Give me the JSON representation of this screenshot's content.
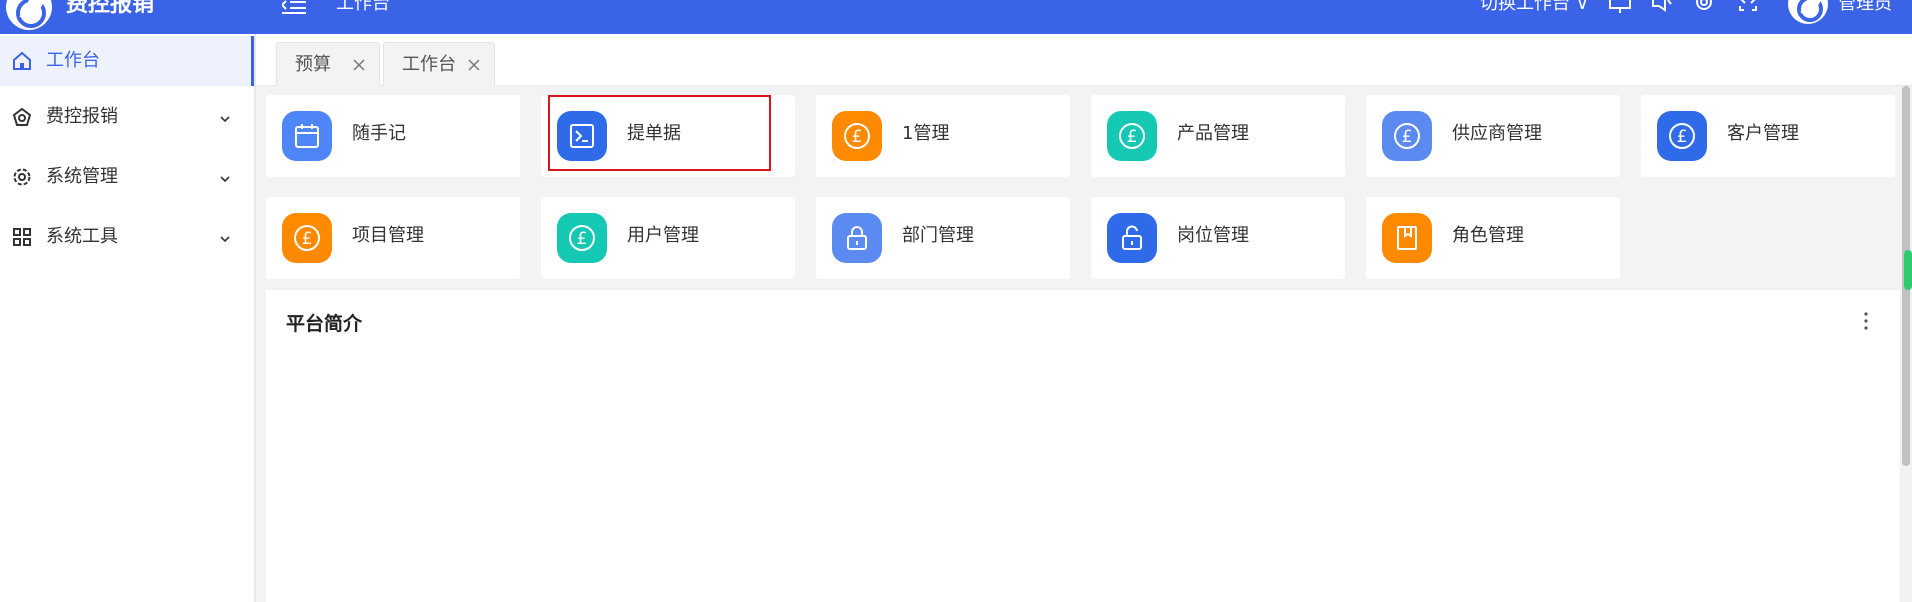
{
  "app": {
    "title": "费控报销"
  },
  "topbar": {
    "page_title": "工作台",
    "switch_workspace": "切换工作台 ∨",
    "user_name": "管理员"
  },
  "sidebar": {
    "items": [
      {
        "label": "工作台",
        "icon": "home-icon",
        "active": true
      },
      {
        "label": "费控报销",
        "icon": "money-icon"
      },
      {
        "label": "系统管理",
        "icon": "gear-icon"
      },
      {
        "label": "系统工具",
        "icon": "grid-icon"
      }
    ]
  },
  "tabs": [
    {
      "label": "预算"
    },
    {
      "label": "工作台"
    }
  ],
  "shortcuts": [
    {
      "label": "随手记",
      "icon": "calendar-icon",
      "color": "#4f86f7"
    },
    {
      "label": "提单据",
      "icon": "terminal-icon",
      "color": "#2f6ae8"
    },
    {
      "label": "1管理",
      "icon": "pound-icon",
      "color": "#ff8a00"
    },
    {
      "label": "产品管理",
      "icon": "pound-icon",
      "color": "#14c8b4"
    },
    {
      "label": "供应商管理",
      "icon": "pound-icon",
      "color": "#5b8af0"
    },
    {
      "label": "客户管理",
      "icon": "pound-icon",
      "color": "#2f6ae8"
    },
    {
      "label": "项目管理",
      "icon": "pound-icon",
      "color": "#ff8a00"
    },
    {
      "label": "用户管理",
      "icon": "pound-icon",
      "color": "#14c8b4"
    },
    {
      "label": "部门管理",
      "icon": "lock-icon",
      "color": "#5b8af0"
    },
    {
      "label": "岗位管理",
      "icon": "unlock-icon",
      "color": "#2f6ae8"
    },
    {
      "label": "角色管理",
      "icon": "book-icon",
      "color": "#ff8a00"
    }
  ],
  "intro": {
    "title": "平台简介"
  },
  "colors": {
    "primary": "#3a63e8",
    "highlight": "#d9141a"
  }
}
